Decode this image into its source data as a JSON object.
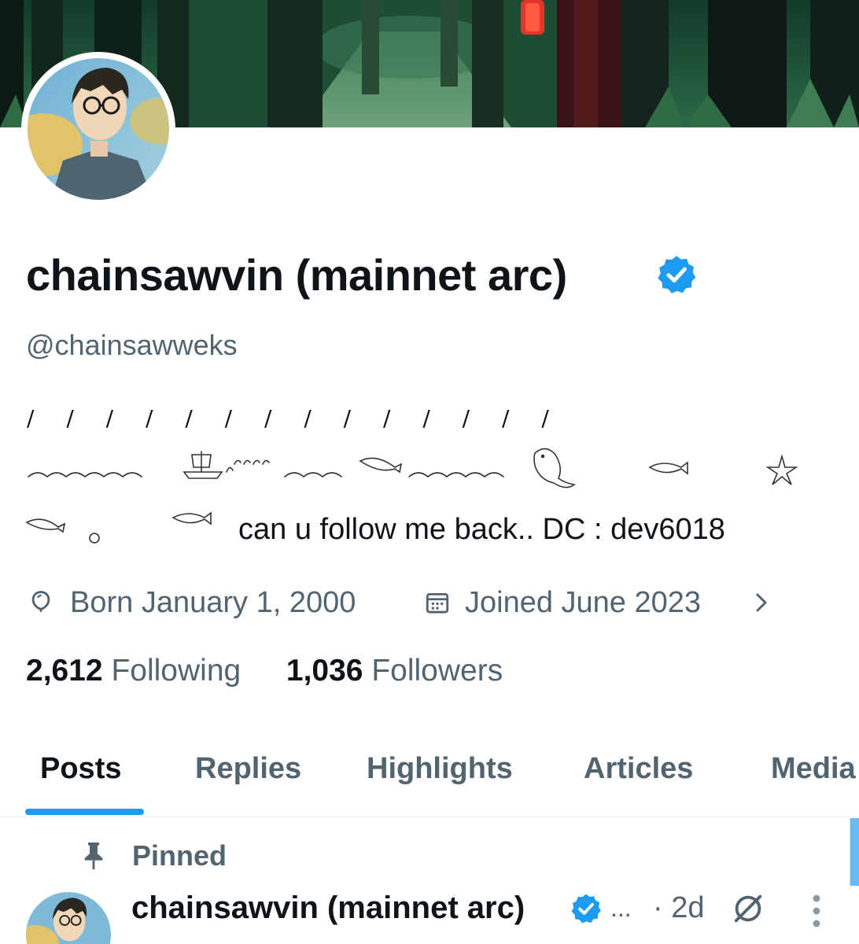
{
  "profile": {
    "display_name": "chainsawvin (mainnet arc)",
    "handle": "@chainsawweks",
    "bio_slashes": "/ / / / / / / / / / / / / /",
    "bio_text": "can u follow me back..  DC : dev6018",
    "born": "Born January 1, 2000",
    "joined": "Joined June 2023",
    "following_count": "2,612",
    "following_label": "Following",
    "followers_count": "1,036",
    "followers_label": "Followers"
  },
  "icons": {
    "verified": "verified-badge-icon",
    "born": "balloon-icon",
    "joined": "calendar-icon",
    "chevron": "chevron-right-icon",
    "pin": "pin-icon",
    "grok": "grok-icon",
    "more": "more-vertical-icon"
  },
  "tabs": [
    {
      "label": "Posts",
      "active": true
    },
    {
      "label": "Replies",
      "active": false
    },
    {
      "label": "Highlights",
      "active": false
    },
    {
      "label": "Articles",
      "active": false
    },
    {
      "label": "Media",
      "active": false
    }
  ],
  "pinned": {
    "label": "Pinned"
  },
  "tweet": {
    "author_name": "chainsawvin (mainnet arc)",
    "ellipsis": "...",
    "time": "· 2d"
  },
  "colors": {
    "accent": "#1d9bf0",
    "text_primary": "#0f1419",
    "text_secondary": "#536471"
  }
}
